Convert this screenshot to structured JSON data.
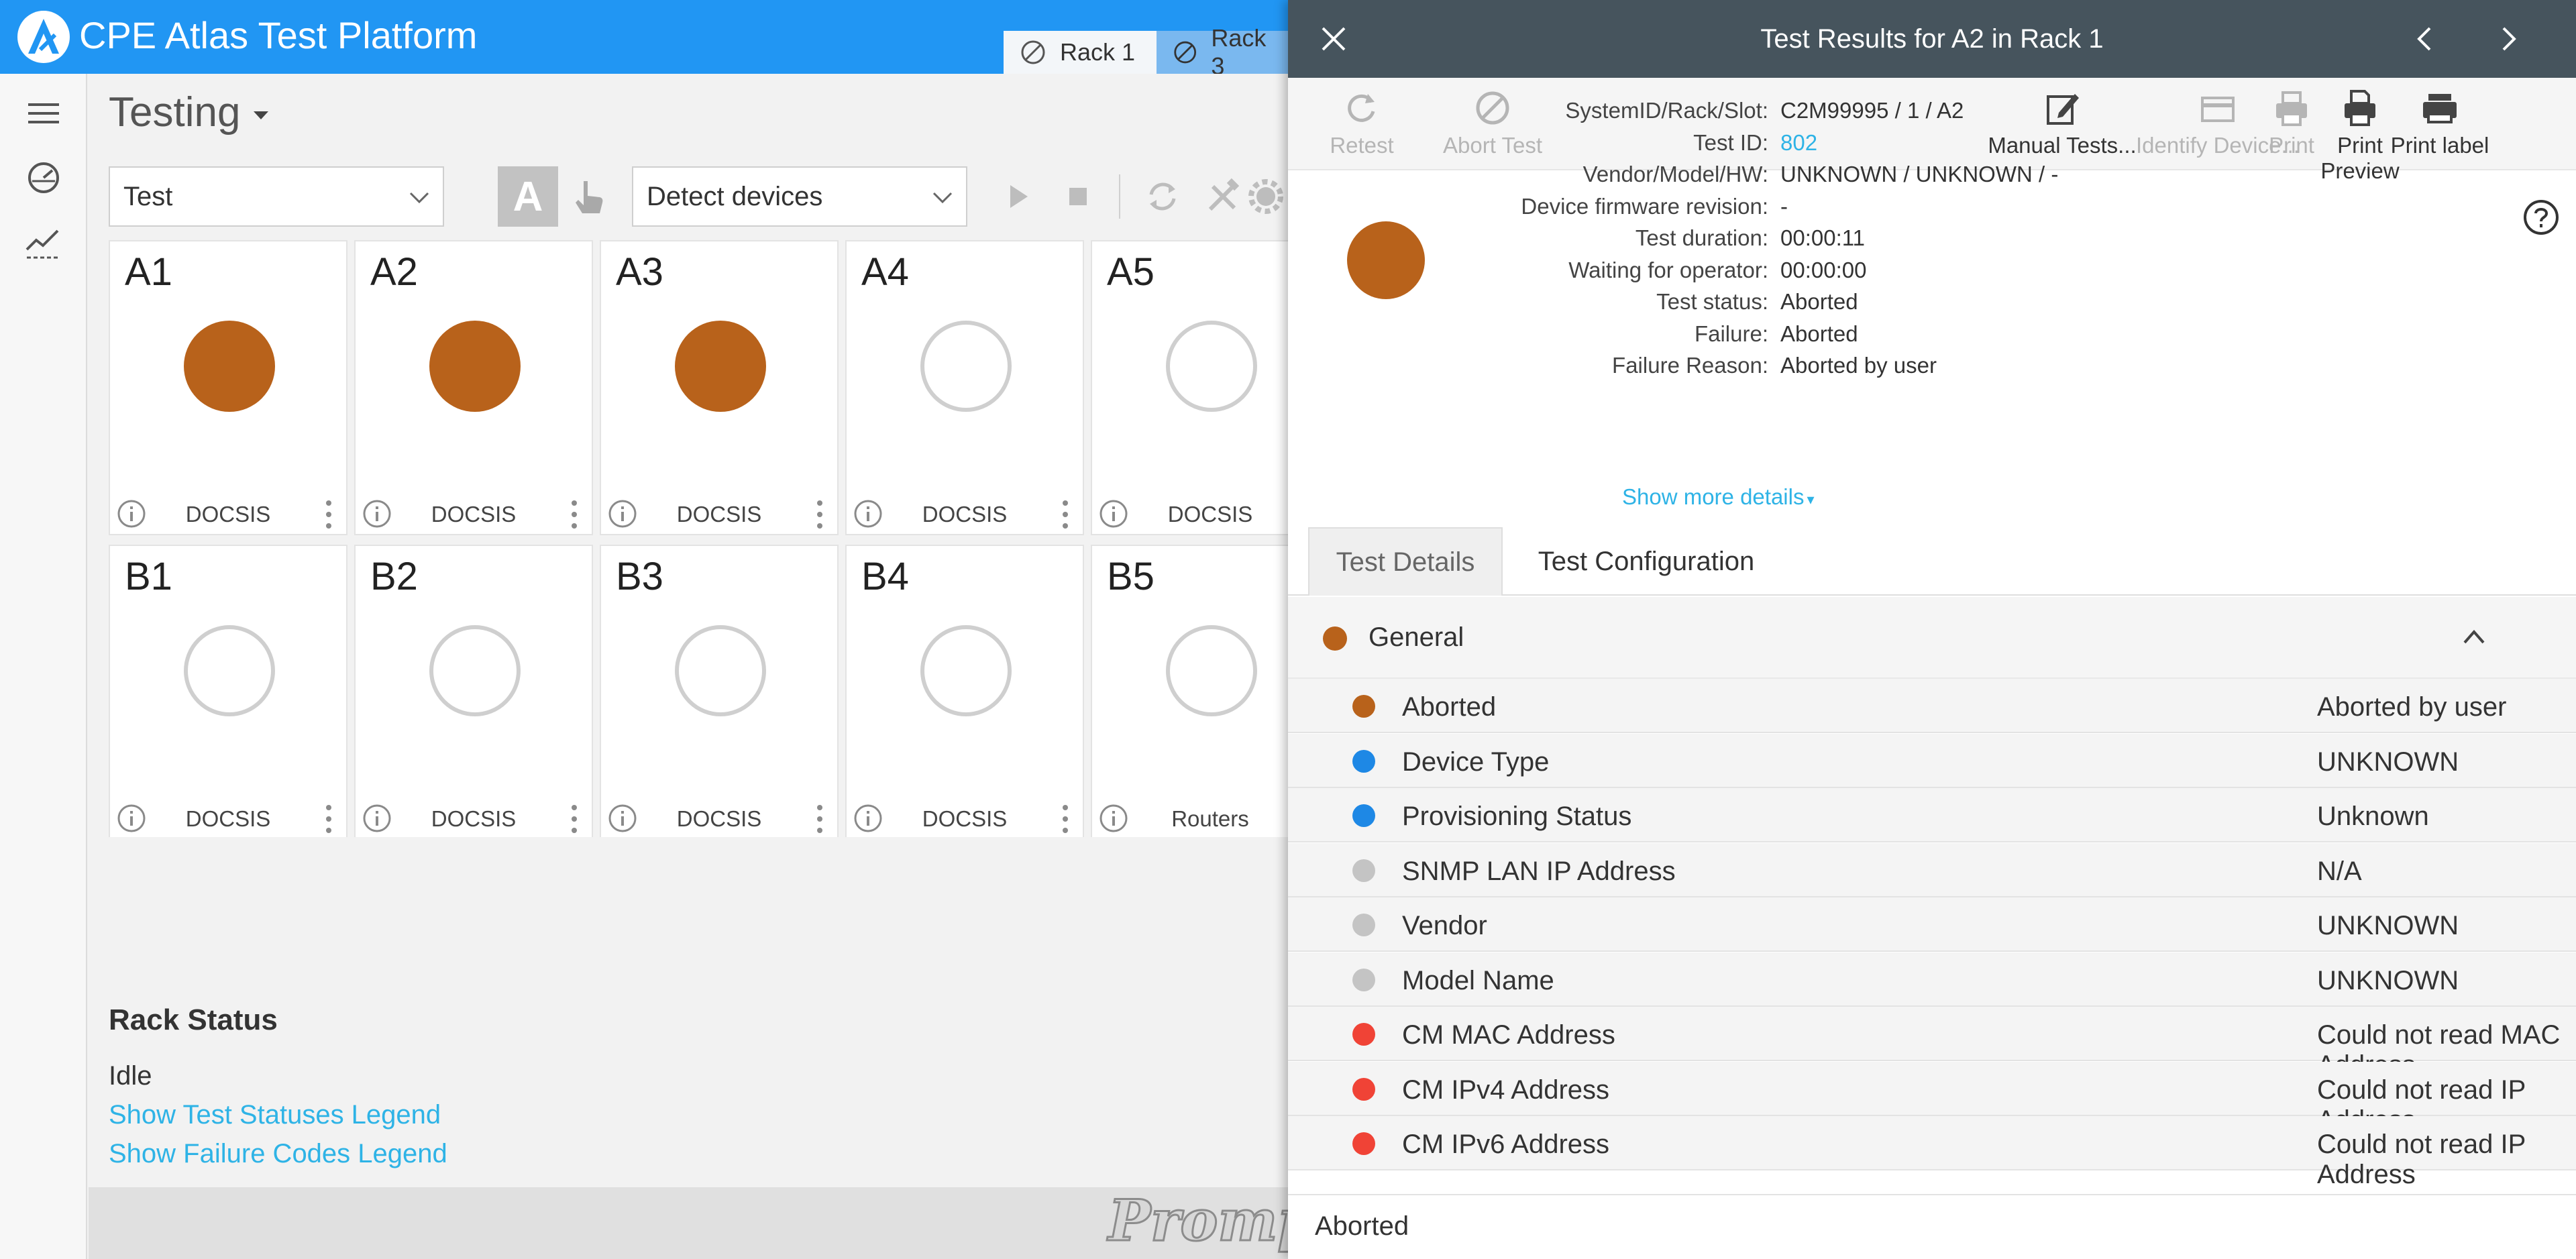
{
  "app": {
    "title": "CPE Atlas Test Platform"
  },
  "rack_tabs": [
    {
      "label": "Rack 1"
    },
    {
      "label": "Rack 3"
    }
  ],
  "page": {
    "title": "Testing"
  },
  "toolbar": {
    "mode_select": "Test",
    "detect_select": "Detect devices",
    "auto_letter": "A"
  },
  "tiles": [
    {
      "label": "A1",
      "type": "DOCSIS",
      "state": "filled"
    },
    {
      "label": "A2",
      "type": "DOCSIS",
      "state": "filled"
    },
    {
      "label": "A3",
      "type": "DOCSIS",
      "state": "filled"
    },
    {
      "label": "A4",
      "type": "DOCSIS",
      "state": "empty"
    },
    {
      "label": "A5",
      "type": "DOCSIS",
      "state": "empty"
    },
    {
      "label": "B1",
      "type": "DOCSIS",
      "state": "empty"
    },
    {
      "label": "B2",
      "type": "DOCSIS",
      "state": "empty"
    },
    {
      "label": "B3",
      "type": "DOCSIS",
      "state": "empty"
    },
    {
      "label": "B4",
      "type": "DOCSIS",
      "state": "empty"
    },
    {
      "label": "B5",
      "type": "Routers",
      "state": "empty"
    }
  ],
  "rack_status": {
    "title": "Rack Status",
    "value": "Idle",
    "legend_link": "Show Test Statuses Legend",
    "failure_link": "Show Failure Codes Legend"
  },
  "footer": {
    "logo_text": "Prompt"
  },
  "panel": {
    "title": "Test Results for A2 in Rack 1",
    "actions": [
      {
        "label": "Retest",
        "icon": "refresh-icon",
        "enabled": false
      },
      {
        "label": "Abort Test",
        "icon": "abort-icon",
        "enabled": false
      },
      {
        "label": "Manual Tests...",
        "icon": "edit-icon",
        "enabled": true
      },
      {
        "label": "Identify Device...",
        "icon": "device-icon",
        "enabled": false
      },
      {
        "label": "Print",
        "icon": "printer-icon",
        "enabled": false
      },
      {
        "label": "Print Preview",
        "icon": "print-preview-icon",
        "enabled": true
      },
      {
        "label": "Print label",
        "icon": "label-printer-icon",
        "enabled": true
      }
    ],
    "info": [
      {
        "key": "SystemID/Rack/Slot:",
        "value": "C2M99995 / 1 / A2"
      },
      {
        "key": "Test ID:",
        "value": "802",
        "link": true
      },
      {
        "key": "Vendor/Model/HW:",
        "value": "UNKNOWN / UNKNOWN / -"
      },
      {
        "key": "Device firmware revision:",
        "value": "-"
      },
      {
        "key": "Test duration:",
        "value": "00:00:11"
      },
      {
        "key": "Waiting for operator:",
        "value": "00:00:00"
      },
      {
        "key": "Test status:",
        "value": "Aborted"
      },
      {
        "key": "Failure:",
        "value": "Aborted"
      },
      {
        "key": "Failure Reason:",
        "value": "Aborted by user"
      }
    ],
    "more_details": "Show more details",
    "tabs": [
      {
        "label": "Test Details"
      },
      {
        "label": "Test Configuration"
      }
    ],
    "section": {
      "title": "General"
    },
    "details": [
      {
        "name": "Aborted",
        "value": "Aborted by user",
        "color": "#b8621b"
      },
      {
        "name": "Device Type",
        "value": "UNKNOWN",
        "color": "#1e88e5"
      },
      {
        "name": "Provisioning Status",
        "value": "Unknown",
        "color": "#1e88e5"
      },
      {
        "name": "SNMP LAN IP Address",
        "value": "N/A",
        "color": "#c4c4c4"
      },
      {
        "name": "Vendor",
        "value": "UNKNOWN",
        "color": "#c4c4c4"
      },
      {
        "name": "Model Name",
        "value": "UNKNOWN",
        "color": "#c4c4c4"
      },
      {
        "name": "CM MAC Address",
        "value": "Could not read MAC Address",
        "color": "#f04336"
      },
      {
        "name": "CM IPv4 Address",
        "value": "Could not read IP Address",
        "color": "#f04336"
      },
      {
        "name": "CM IPv6 Address",
        "value": "Could not read IP Address",
        "color": "#f04336"
      }
    ],
    "bottom_status": "Aborted"
  },
  "colors": {
    "brand_blue": "#2196f3",
    "panel_header": "#46545d",
    "status_aborted": "#b8621b",
    "link": "#2eb3e6"
  }
}
